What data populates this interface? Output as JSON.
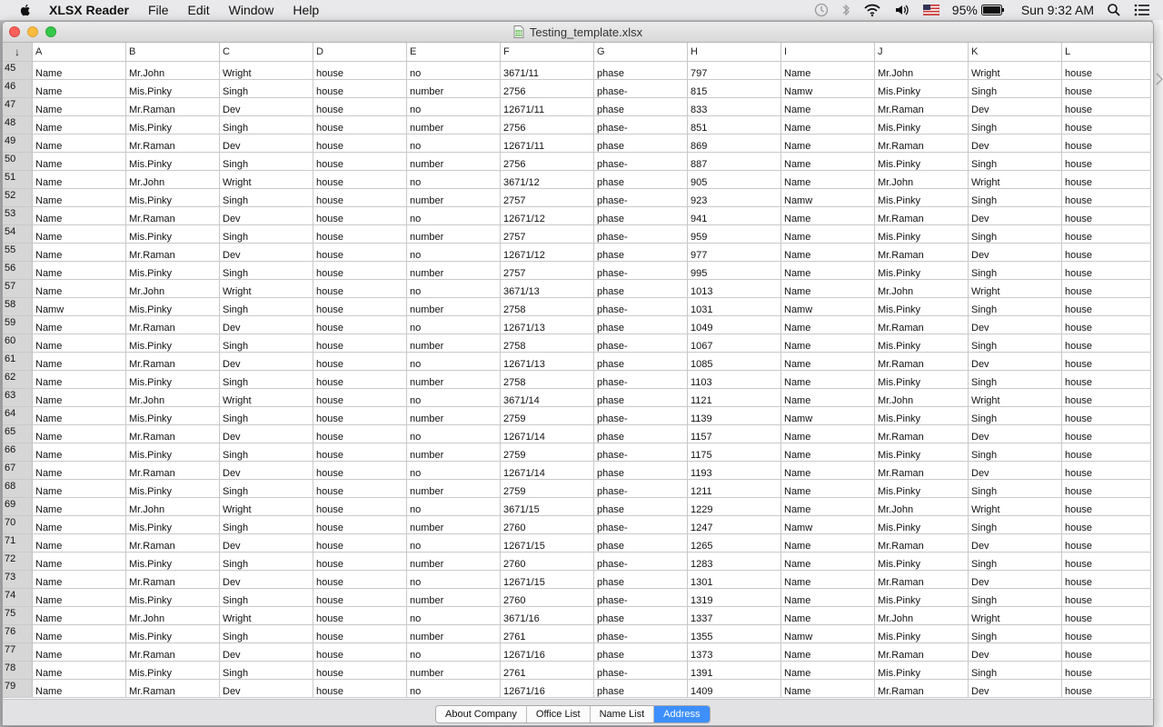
{
  "menubar": {
    "app_name": "XLSX Reader",
    "menus": [
      "File",
      "Edit",
      "Window",
      "Help"
    ],
    "battery": "95%",
    "clock": "Sun 9:32 AM"
  },
  "window": {
    "title": "Testing_template.xlsx"
  },
  "grid": {
    "corner": "↓",
    "columns": [
      "A",
      "B",
      "C",
      "D",
      "E",
      "F",
      "G",
      "H",
      "I",
      "J",
      "K",
      "L"
    ],
    "rows": [
      {
        "n": "45",
        "cells": [
          "Name",
          "Mr.John",
          "Wright",
          "house",
          "no",
          "3671/11",
          "phase",
          "797",
          "Name",
          "Mr.John",
          "Wright",
          "house"
        ]
      },
      {
        "n": "46",
        "cells": [
          "Name",
          "Mis.Pinky",
          "Singh",
          "house",
          "number",
          "2756",
          "phase-",
          "815",
          "Namw",
          "Mis.Pinky",
          "Singh",
          "house"
        ]
      },
      {
        "n": "47",
        "cells": [
          "Name",
          "Mr.Raman",
          "Dev",
          "house",
          "no",
          "12671/11",
          "phase",
          "833",
          "Name",
          "Mr.Raman",
          "Dev",
          "house"
        ]
      },
      {
        "n": "48",
        "cells": [
          "Name",
          "Mis.Pinky",
          "Singh",
          "house",
          "number",
          "2756",
          "phase-",
          "851",
          "Name",
          "Mis.Pinky",
          "Singh",
          "house"
        ]
      },
      {
        "n": "49",
        "cells": [
          "Name",
          "Mr.Raman",
          "Dev",
          "house",
          "no",
          "12671/11",
          "phase",
          "869",
          "Name",
          "Mr.Raman",
          "Dev",
          "house"
        ]
      },
      {
        "n": "50",
        "cells": [
          "Name",
          "Mis.Pinky",
          "Singh",
          "house",
          "number",
          "2756",
          "phase-",
          "887",
          "Name",
          "Mis.Pinky",
          "Singh",
          "house"
        ]
      },
      {
        "n": "51",
        "cells": [
          "Name",
          "Mr.John",
          "Wright",
          "house",
          "no",
          "3671/12",
          "phase",
          "905",
          "Name",
          "Mr.John",
          "Wright",
          "house"
        ]
      },
      {
        "n": "52",
        "cells": [
          "Name",
          "Mis.Pinky",
          "Singh",
          "house",
          "number",
          "2757",
          "phase-",
          "923",
          "Namw",
          "Mis.Pinky",
          "Singh",
          "house"
        ]
      },
      {
        "n": "53",
        "cells": [
          "Name",
          "Mr.Raman",
          "Dev",
          "house",
          "no",
          "12671/12",
          "phase",
          "941",
          "Name",
          "Mr.Raman",
          "Dev",
          "house"
        ]
      },
      {
        "n": "54",
        "cells": [
          "Name",
          "Mis.Pinky",
          "Singh",
          "house",
          "number",
          "2757",
          "phase-",
          "959",
          "Name",
          "Mis.Pinky",
          "Singh",
          "house"
        ]
      },
      {
        "n": "55",
        "cells": [
          "Name",
          "Mr.Raman",
          "Dev",
          "house",
          "no",
          "12671/12",
          "phase",
          "977",
          "Name",
          "Mr.Raman",
          "Dev",
          "house"
        ]
      },
      {
        "n": "56",
        "cells": [
          "Name",
          "Mis.Pinky",
          "Singh",
          "house",
          "number",
          "2757",
          "phase-",
          "995",
          "Name",
          "Mis.Pinky",
          "Singh",
          "house"
        ]
      },
      {
        "n": "57",
        "cells": [
          "Name",
          "Mr.John",
          "Wright",
          "house",
          "no",
          "3671/13",
          "phase",
          "1013",
          "Name",
          "Mr.John",
          "Wright",
          "house"
        ]
      },
      {
        "n": "58",
        "cells": [
          "Namw",
          "Mis.Pinky",
          "Singh",
          "house",
          "number",
          "2758",
          "phase-",
          "1031",
          "Namw",
          "Mis.Pinky",
          "Singh",
          "house"
        ]
      },
      {
        "n": "59",
        "cells": [
          "Name",
          "Mr.Raman",
          "Dev",
          "house",
          "no",
          "12671/13",
          "phase",
          "1049",
          "Name",
          "Mr.Raman",
          "Dev",
          "house"
        ]
      },
      {
        "n": "60",
        "cells": [
          "Name",
          "Mis.Pinky",
          "Singh",
          "house",
          "number",
          "2758",
          "phase-",
          "1067",
          "Name",
          "Mis.Pinky",
          "Singh",
          "house"
        ]
      },
      {
        "n": "61",
        "cells": [
          "Name",
          "Mr.Raman",
          "Dev",
          "house",
          "no",
          "12671/13",
          "phase",
          "1085",
          "Name",
          "Mr.Raman",
          "Dev",
          "house"
        ]
      },
      {
        "n": "62",
        "cells": [
          "Name",
          "Mis.Pinky",
          "Singh",
          "house",
          "number",
          "2758",
          "phase-",
          "1103",
          "Name",
          "Mis.Pinky",
          "Singh",
          "house"
        ]
      },
      {
        "n": "63",
        "cells": [
          "Name",
          "Mr.John",
          "Wright",
          "house",
          "no",
          "3671/14",
          "phase",
          "1121",
          "Name",
          "Mr.John",
          "Wright",
          "house"
        ]
      },
      {
        "n": "64",
        "cells": [
          "Name",
          "Mis.Pinky",
          "Singh",
          "house",
          "number",
          "2759",
          "phase-",
          "1139",
          "Namw",
          "Mis.Pinky",
          "Singh",
          "house"
        ]
      },
      {
        "n": "65",
        "cells": [
          "Name",
          "Mr.Raman",
          "Dev",
          "house",
          "no",
          "12671/14",
          "phase",
          "1157",
          "Name",
          "Mr.Raman",
          "Dev",
          "house"
        ]
      },
      {
        "n": "66",
        "cells": [
          "Name",
          "Mis.Pinky",
          "Singh",
          "house",
          "number",
          "2759",
          "phase-",
          "1175",
          "Name",
          "Mis.Pinky",
          "Singh",
          "house"
        ]
      },
      {
        "n": "67",
        "cells": [
          "Name",
          "Mr.Raman",
          "Dev",
          "house",
          "no",
          "12671/14",
          "phase",
          "1193",
          "Name",
          "Mr.Raman",
          "Dev",
          "house"
        ]
      },
      {
        "n": "68",
        "cells": [
          "Name",
          "Mis.Pinky",
          "Singh",
          "house",
          "number",
          "2759",
          "phase-",
          "1211",
          "Name",
          "Mis.Pinky",
          "Singh",
          "house"
        ]
      },
      {
        "n": "69",
        "cells": [
          "Name",
          "Mr.John",
          "Wright",
          "house",
          "no",
          "3671/15",
          "phase",
          "1229",
          "Name",
          "Mr.John",
          "Wright",
          "house"
        ]
      },
      {
        "n": "70",
        "cells": [
          "Name",
          "Mis.Pinky",
          "Singh",
          "house",
          "number",
          "2760",
          "phase-",
          "1247",
          "Namw",
          "Mis.Pinky",
          "Singh",
          "house"
        ]
      },
      {
        "n": "71",
        "cells": [
          "Name",
          "Mr.Raman",
          "Dev",
          "house",
          "no",
          "12671/15",
          "phase",
          "1265",
          "Name",
          "Mr.Raman",
          "Dev",
          "house"
        ]
      },
      {
        "n": "72",
        "cells": [
          "Name",
          "Mis.Pinky",
          "Singh",
          "house",
          "number",
          "2760",
          "phase-",
          "1283",
          "Name",
          "Mis.Pinky",
          "Singh",
          "house"
        ]
      },
      {
        "n": "73",
        "cells": [
          "Name",
          "Mr.Raman",
          "Dev",
          "house",
          "no",
          "12671/15",
          "phase",
          "1301",
          "Name",
          "Mr.Raman",
          "Dev",
          "house"
        ]
      },
      {
        "n": "74",
        "cells": [
          "Name",
          "Mis.Pinky",
          "Singh",
          "house",
          "number",
          "2760",
          "phase-",
          "1319",
          "Name",
          "Mis.Pinky",
          "Singh",
          "house"
        ]
      },
      {
        "n": "75",
        "cells": [
          "Name",
          "Mr.John",
          "Wright",
          "house",
          "no",
          "3671/16",
          "phase",
          "1337",
          "Name",
          "Mr.John",
          "Wright",
          "house"
        ]
      },
      {
        "n": "76",
        "cells": [
          "Name",
          "Mis.Pinky",
          "Singh",
          "house",
          "number",
          "2761",
          "phase-",
          "1355",
          "Namw",
          "Mis.Pinky",
          "Singh",
          "house"
        ]
      },
      {
        "n": "77",
        "cells": [
          "Name",
          "Mr.Raman",
          "Dev",
          "house",
          "no",
          "12671/16",
          "phase",
          "1373",
          "Name",
          "Mr.Raman",
          "Dev",
          "house"
        ]
      },
      {
        "n": "78",
        "cells": [
          "Name",
          "Mis.Pinky",
          "Singh",
          "house",
          "number",
          "2761",
          "phase-",
          "1391",
          "Name",
          "Mis.Pinky",
          "Singh",
          "house"
        ]
      },
      {
        "n": "79",
        "cells": [
          "Name",
          "Mr.Raman",
          "Dev",
          "house",
          "no",
          "12671/16",
          "phase",
          "1409",
          "Name",
          "Mr.Raman",
          "Dev",
          "house"
        ]
      }
    ]
  },
  "sheet_tabs": [
    {
      "label": "About Company",
      "active": false
    },
    {
      "label": "Office List",
      "active": false
    },
    {
      "label": "Name List",
      "active": false
    },
    {
      "label": "Address",
      "active": true
    }
  ],
  "colors": {
    "menubar_bg": "#e9e9eb",
    "rownum_bg": "#d6d6d6",
    "active_tab": "#3d8fff",
    "close": "#fc605b",
    "minimize": "#fdbc40",
    "maximize": "#34c84a"
  },
  "icons": [
    "apple-icon",
    "time-machine-icon",
    "bluetooth-icon",
    "wifi-icon",
    "volume-icon",
    "us-flag-icon",
    "battery-icon",
    "spotlight-search-icon",
    "notification-list-icon",
    "spreadsheet-document-icon"
  ]
}
